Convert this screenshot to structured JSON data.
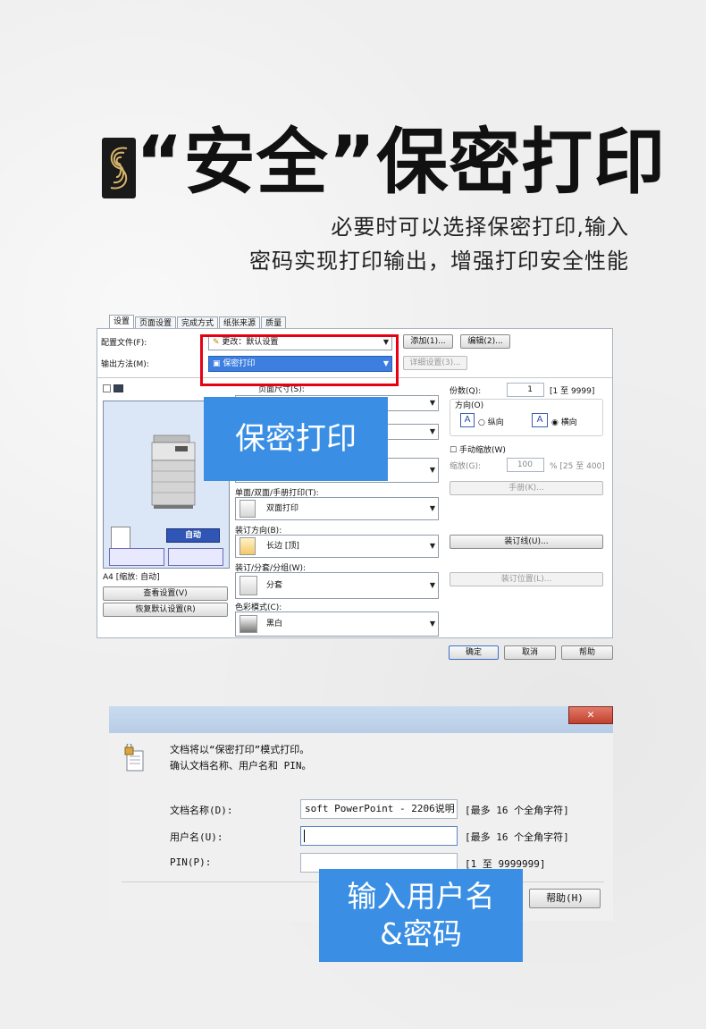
{
  "header": {
    "badge_glyph": "S",
    "title": "“安全”保密打印",
    "subtitle_line1": "必要时可以选择保密打印,输入",
    "subtitle_line2": "密码实现打印输出，增强打印安全性能"
  },
  "print_dialog": {
    "tabs": [
      "设置",
      "页面设置",
      "完成方式",
      "纸张来源",
      "质量"
    ],
    "profile_label": "配置文件(F):",
    "profile_value": "更改：默认设置",
    "output_method_label": "输出方法(M):",
    "output_method_value": "保密打印",
    "add_button": "添加(1)...",
    "edit_button": "编辑(2)...",
    "detail_button": "详细设置(3)...",
    "page_size_label": "页面尺寸(S):",
    "duplex_label": "单面/双面/手册打印(T):",
    "duplex_value": "双面打印",
    "binding_label": "装订方向(B):",
    "binding_value": "长边 [顶]",
    "staple_label": "装订/分套/分组(W):",
    "staple_value": "分套",
    "color_label": "色彩模式(C):",
    "color_value": "黑白",
    "copies_label": "份数(Q):",
    "copies_value": "1",
    "copies_range": "[1 至 9999]",
    "orientation_label": "方向(O)",
    "portrait": "纵向",
    "landscape": "横向",
    "manual_zoom": "手动缩放(W)",
    "zoom_label": "缩放(G):",
    "zoom_value": "100",
    "zoom_range": "% [25 至 400]",
    "booklet_button": "手册(K)...",
    "gutter_button": "装订线(U)...",
    "binding_pos_button": "装订位置(L)...",
    "auto_button": "自动",
    "preview_caption": "A4 [缩放: 自动]",
    "view_settings_button": "查看设置(V)",
    "restore_button": "恢复默认设置(R)",
    "ok_button": "确定",
    "cancel_button": "取消",
    "help_button": "帮助",
    "overlay_text": "保密打印"
  },
  "secure_dialog": {
    "close_glyph": "✕",
    "message_line1": "文档将以“保密打印”模式打印。",
    "message_line2": "确认文档名称、用户名和 PIN。",
    "doc_name_label": "文档名称(D):",
    "doc_name_value": "soft PowerPoint - 2206说明",
    "doc_name_hint": "[最多 16 个全角字符]",
    "user_label": "用户名(U):",
    "user_value": "",
    "user_hint": "[最多 16 个全角字符]",
    "pin_label": "PIN(P):",
    "pin_value": "",
    "pin_hint": "[1 至 9999999]",
    "help_button": "帮助(H)",
    "overlay_line1": "输入用户名",
    "overlay_line2": "&密码"
  },
  "colors": {
    "accent_blue": "#3a8fe4",
    "highlight_red": "#e60012",
    "selection_blue": "#3d7fe0"
  }
}
